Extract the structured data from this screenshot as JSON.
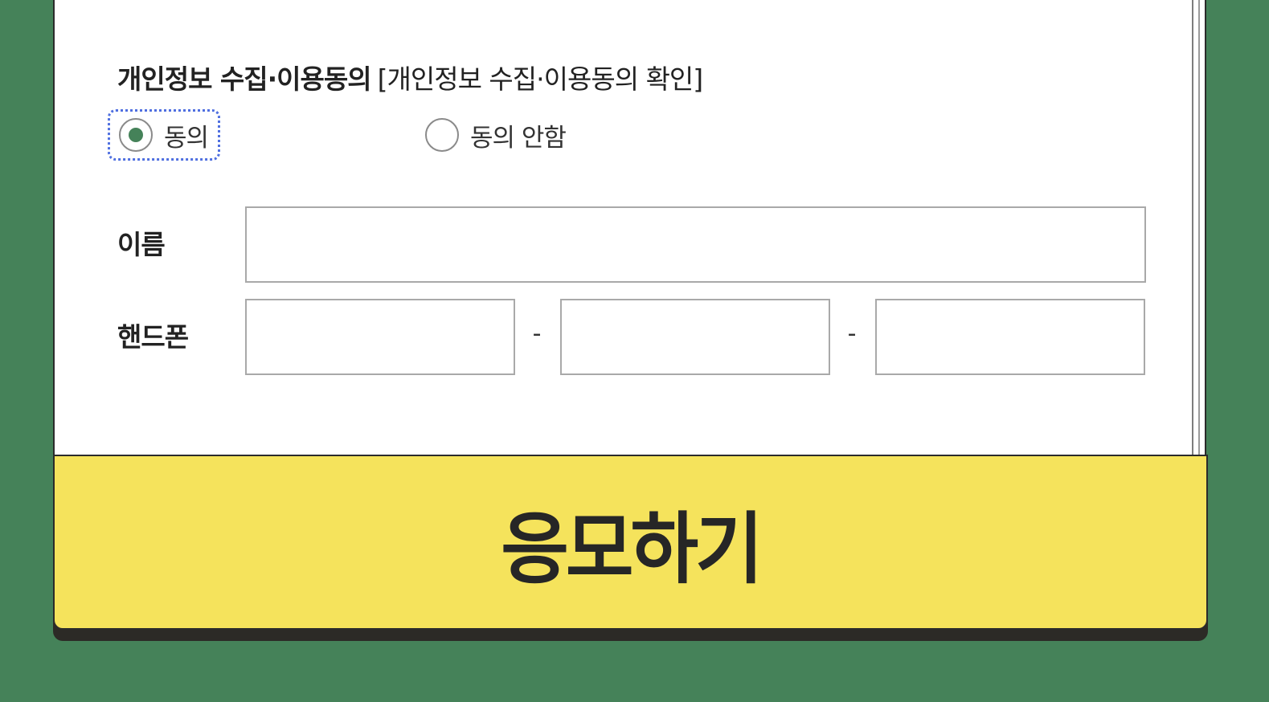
{
  "colors": {
    "background": "#458259",
    "card": "#ffffff",
    "accent": "#458259",
    "button": "#f5e35c",
    "focus_ring": "#4f6fe0"
  },
  "consent": {
    "title": "개인정보 수집·이용동의",
    "subtitle": "[개인정보 수집·이용동의 확인]",
    "options": [
      {
        "label": "동의",
        "selected": true
      },
      {
        "label": "동의 안함",
        "selected": false
      }
    ]
  },
  "form": {
    "name_label": "이름",
    "name_value": "",
    "phone_label": "핸드폰",
    "phone_parts": [
      "",
      "",
      ""
    ],
    "phone_separator": "-"
  },
  "submit": {
    "label": "응모하기"
  }
}
